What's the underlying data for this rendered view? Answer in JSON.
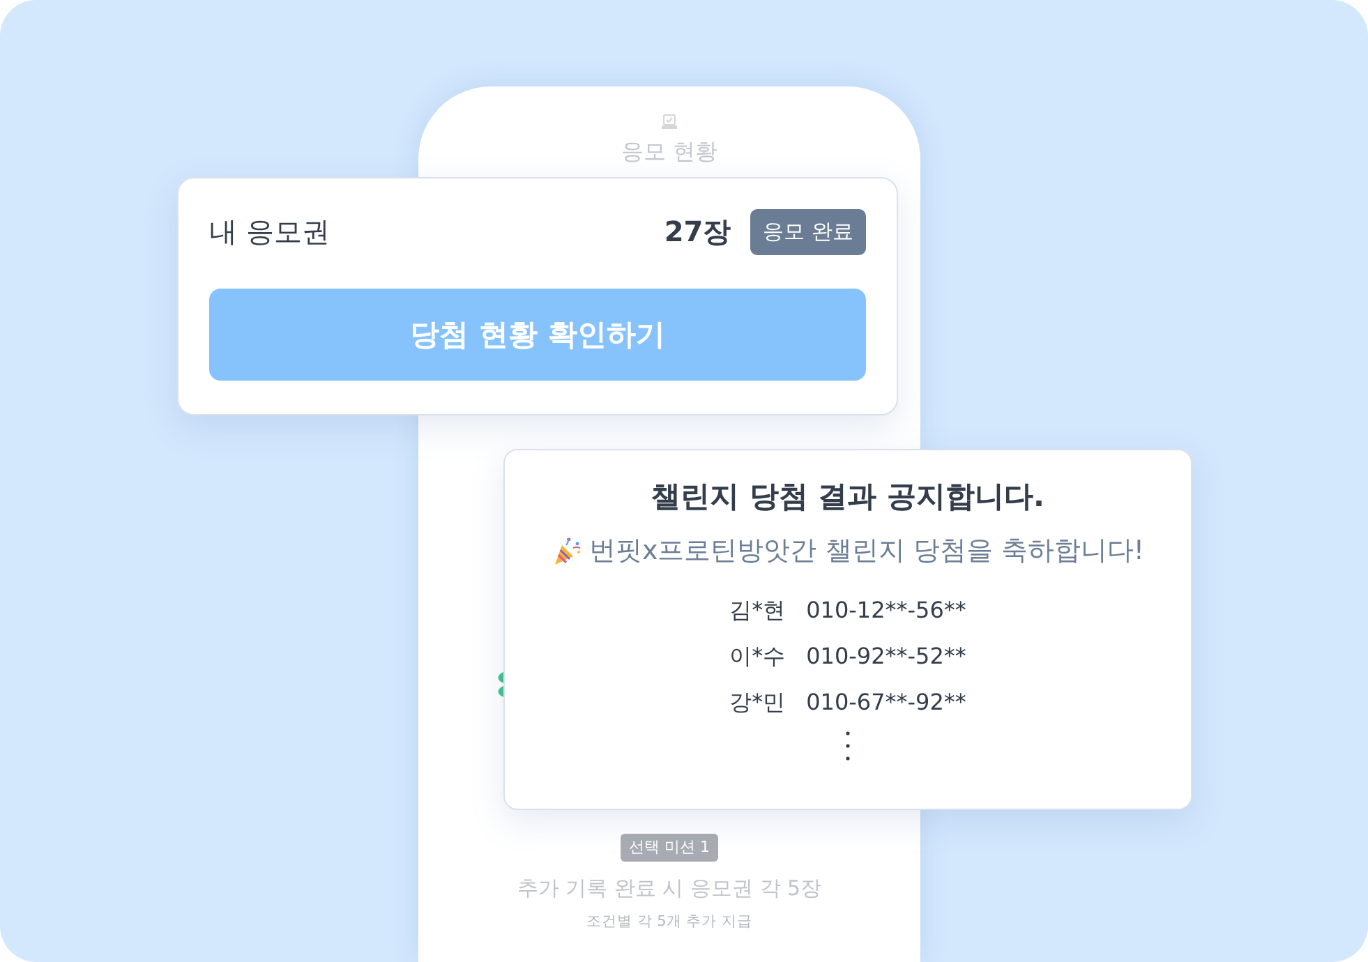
{
  "phone": {
    "header": {
      "title": "응모 현황"
    },
    "mission": {
      "badge": "선택 미션 1",
      "title": "추가 기록 완료 시 응모권 각 5장",
      "note": "조건별 각 5개 추가 지급"
    }
  },
  "ticket_card": {
    "label": "내 응모권",
    "count": "27장",
    "status": "응모 완료",
    "button": "당첨 현황 확인하기"
  },
  "notice_card": {
    "title": "챌린지 당첨 결과 공지합니다.",
    "subtitle": "번핏x프로틴방앗간 챌린지 당첨을 축하합니다!",
    "winners": [
      {
        "name": "김*현",
        "phone": "010-12**-56**"
      },
      {
        "name": "이*수",
        "phone": "010-92**-52**"
      },
      {
        "name": "강*민",
        "phone": "010-67**-92**"
      }
    ]
  }
}
